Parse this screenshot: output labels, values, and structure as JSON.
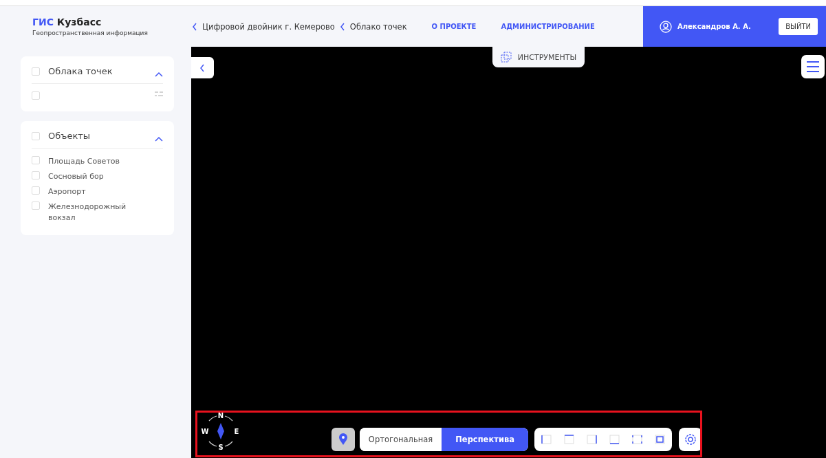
{
  "header": {
    "logo_accent": "ГИС",
    "logo_rest": "Кузбасс",
    "subtitle": "Геопространственная информация",
    "breadcrumbs": [
      "Цифровой двойник г. Кемерово",
      "Облако точек"
    ],
    "nav": [
      "О ПРОЕКТЕ",
      "АДМИНИСТРИРОВАНИЕ"
    ],
    "user": "Александров А. А.",
    "logout": "ВЫЙТИ"
  },
  "panels": [
    {
      "title": "Облака точек",
      "checked": false,
      "expanded": true,
      "items": [
        {
          "checked": false,
          "kind": "settings"
        }
      ]
    },
    {
      "title": "Объекты",
      "checked": false,
      "expanded": true,
      "items": [
        {
          "label": "Площадь Советов",
          "checked": false,
          "kind": "plain"
        },
        {
          "label": "Сосновый бор",
          "checked": false,
          "kind": "plain"
        },
        {
          "label": "Аэропорт",
          "checked": false,
          "kind": "plain"
        },
        {
          "label": "Железнодорожный вокзал",
          "checked": false,
          "kind": "plain"
        }
      ]
    }
  ],
  "tools_button": "ИНСТРУМЕНТЫ",
  "compass": {
    "n": "N",
    "s": "S",
    "w": "W",
    "e": "E"
  },
  "projection": [
    {
      "label": "Ортогональная",
      "selected": false
    },
    {
      "label": "Перспектива",
      "selected": true
    }
  ],
  "views": [
    {
      "kind": "left"
    },
    {
      "kind": "top"
    },
    {
      "kind": "right"
    },
    {
      "kind": "bottom"
    },
    {
      "kind": "front"
    },
    {
      "kind": "back"
    }
  ]
}
